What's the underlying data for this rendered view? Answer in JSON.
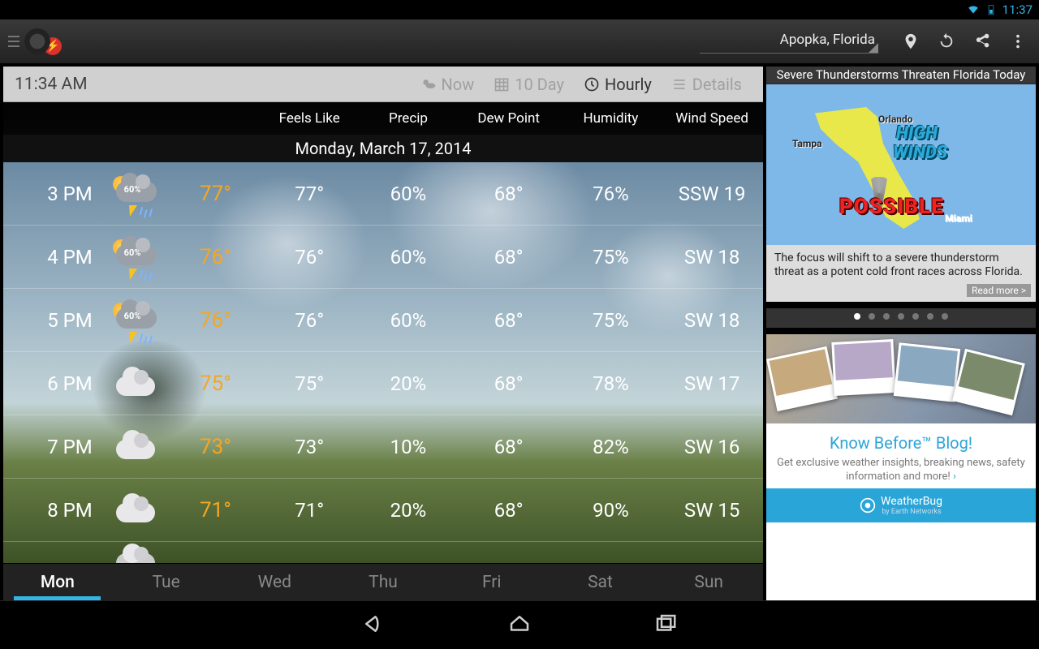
{
  "statusbar": {
    "time": "11:37"
  },
  "actionbar": {
    "location": "Apopka, Florida"
  },
  "viewheader": {
    "current_time": "11:34 AM",
    "tabs": {
      "now": "Now",
      "tenday": "10 Day",
      "hourly": "Hourly",
      "details": "Details"
    }
  },
  "columns": {
    "feels": "Feels Like",
    "precip": "Precip",
    "dew": "Dew Point",
    "humidity": "Humidity",
    "wind": "Wind Speed"
  },
  "date_banner": "Monday, March 17, 2014",
  "hours": [
    {
      "time": "3 PM",
      "icon": "storm",
      "icon_pct": "60%",
      "temp": "77°",
      "feels": "77°",
      "precip": "60%",
      "dew": "68°",
      "hum": "76%",
      "wind": "SSW 19"
    },
    {
      "time": "4 PM",
      "icon": "storm",
      "icon_pct": "60%",
      "temp": "76°",
      "feels": "76°",
      "precip": "60%",
      "dew": "68°",
      "hum": "75%",
      "wind": "SW 18"
    },
    {
      "time": "5 PM",
      "icon": "storm",
      "icon_pct": "60%",
      "temp": "76°",
      "feels": "76°",
      "precip": "60%",
      "dew": "68°",
      "hum": "75%",
      "wind": "SW 18"
    },
    {
      "time": "6 PM",
      "icon": "cloud",
      "icon_pct": "",
      "temp": "75°",
      "feels": "75°",
      "precip": "20%",
      "dew": "68°",
      "hum": "78%",
      "wind": "SW 17"
    },
    {
      "time": "7 PM",
      "icon": "cloud",
      "icon_pct": "",
      "temp": "73°",
      "feels": "73°",
      "precip": "10%",
      "dew": "68°",
      "hum": "82%",
      "wind": "SW 16"
    },
    {
      "time": "8 PM",
      "icon": "cloud",
      "icon_pct": "",
      "temp": "71°",
      "feels": "71°",
      "precip": "20%",
      "dew": "68°",
      "hum": "90%",
      "wind": "SW 15"
    }
  ],
  "daytabs": [
    "Mon",
    "Tue",
    "Wed",
    "Thu",
    "Fri",
    "Sat",
    "Sun"
  ],
  "daytabs_active": 0,
  "news": {
    "headline": "Severe Thunderstorms Threaten Florida Today",
    "map": {
      "tampa": "Tampa",
      "orlando": "Orlando",
      "miami": "Miami",
      "high": "HIGH",
      "winds": "WINDS",
      "possible": "POSSIBLE"
    },
    "body": "The focus will shift to a severe thunderstorm threat as a potent cold front races across Florida.",
    "readmore": "Read more >",
    "dot_count": 7,
    "dot_active": 0
  },
  "blog": {
    "title": "Know Before™ Blog!",
    "desc": "Get exclusive weather insights, breaking news, safety information and more!",
    "footer_brand": "WeatherBug",
    "footer_by": "by Earth Networks"
  }
}
